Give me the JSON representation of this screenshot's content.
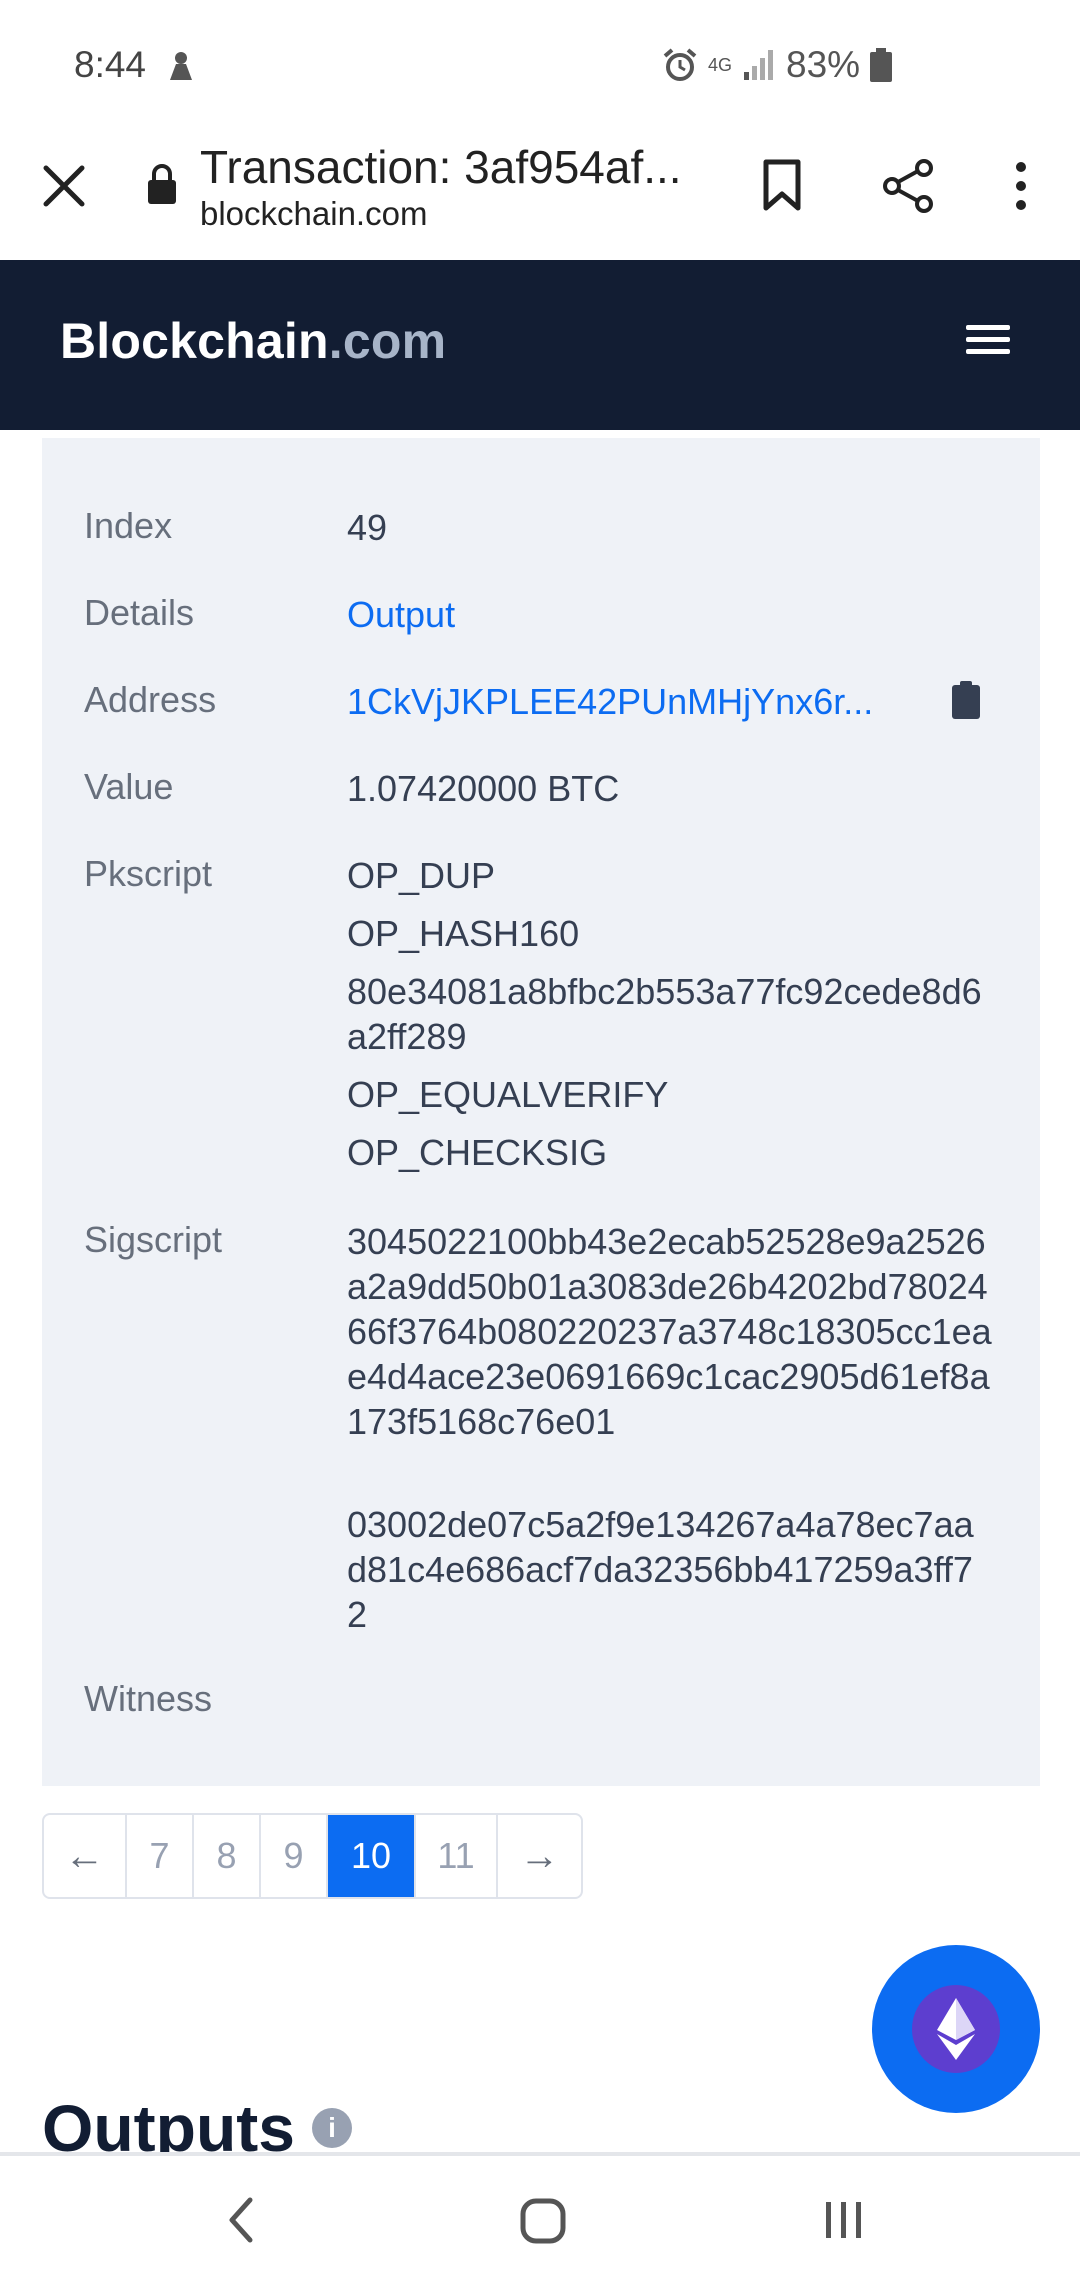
{
  "status_bar": {
    "time": "8:44",
    "network": "4G",
    "battery": "83%",
    "icons": [
      "notification-icon",
      "alarm-icon",
      "network-icon",
      "signal-icon",
      "battery-icon"
    ]
  },
  "browser": {
    "tab_title": "Transaction: 3af954af...",
    "domain": "blockchain.com",
    "icons": [
      "close-icon",
      "lock-icon",
      "bookmark-icon",
      "share-icon",
      "more-icon"
    ]
  },
  "site_header": {
    "brand_main": "Blockchain",
    "brand_tld": ".com",
    "menu_icon": "hamburger-menu-icon"
  },
  "details": {
    "index_label": "Index",
    "index_value": "49",
    "details_label": "Details",
    "details_value": "Output",
    "address_label": "Address",
    "address_value": "1CkVjJKPLEE42PUnMHjYnx6r...",
    "value_label": "Value",
    "value_value": "1.07420000 BTC",
    "pkscript_label": "Pkscript",
    "pkscript_lines": [
      "OP_DUP",
      "OP_HASH160",
      "80e34081a8bfbc2b553a77fc92cede8d6a2ff289",
      "OP_EQUALVERIFY",
      "OP_CHECKSIG"
    ],
    "sigscript_label": "Sigscript",
    "sigscript_lines": [
      "3045022100bb43e2ecab52528e9a2526a2a9dd50b01a3083de26b4202bd7802466f3764b080220237a3748c18305cc1eae4d4ace23e0691669c1cac2905d61ef8a173f5168c76e01",
      "03002de07c5a2f9e134267a4a78ec7aad81c4e686acf7da32356bb417259a3ff72"
    ],
    "witness_label": "Witness"
  },
  "pagination": {
    "prev": "←",
    "pages": [
      "7",
      "8",
      "9",
      "10",
      "11"
    ],
    "active": "10",
    "next": "→"
  },
  "outputs": {
    "title": "Outputs",
    "info": "i"
  },
  "colors": {
    "header_bg": "#121d33",
    "accent": "#0c6cf2",
    "panel_bg": "#eff2f7",
    "fab_inner": "#5d3ecf"
  }
}
